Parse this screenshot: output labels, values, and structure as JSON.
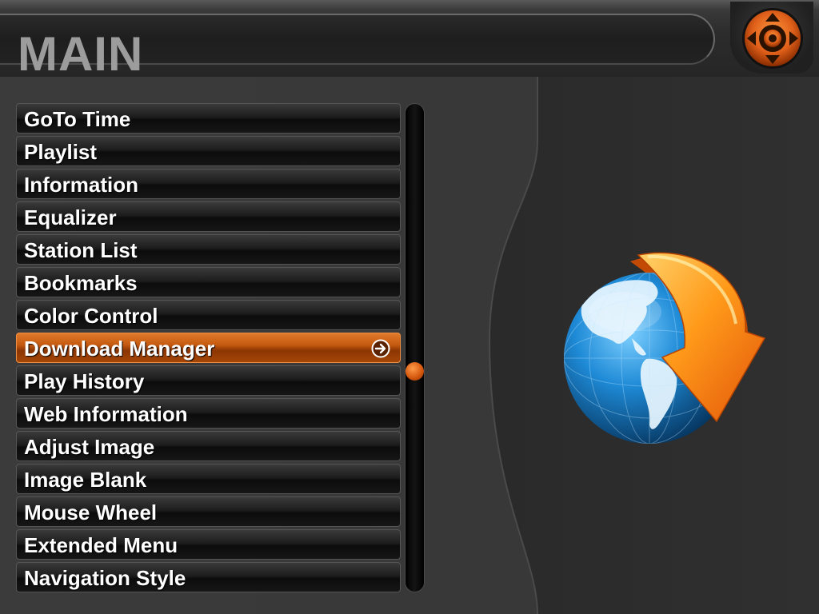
{
  "header": {
    "title": "MAIN"
  },
  "nav_control": {
    "icon": "directional-pad-icon",
    "accent_color": "#e8661a"
  },
  "menu": {
    "items": [
      {
        "label": "GoTo Time",
        "selected": false
      },
      {
        "label": "Playlist",
        "selected": false
      },
      {
        "label": "Information",
        "selected": false
      },
      {
        "label": "Equalizer",
        "selected": false
      },
      {
        "label": "Station List",
        "selected": false
      },
      {
        "label": "Bookmarks",
        "selected": false
      },
      {
        "label": "Color Control",
        "selected": false
      },
      {
        "label": "Download Manager",
        "selected": true,
        "icon": "arrow-right-circle-icon"
      },
      {
        "label": "Play History",
        "selected": false
      },
      {
        "label": "Web Information",
        "selected": false
      },
      {
        "label": "Adjust Image",
        "selected": false
      },
      {
        "label": "Image Blank",
        "selected": false
      },
      {
        "label": "Mouse Wheel",
        "selected": false
      },
      {
        "label": "Extended Menu",
        "selected": false
      },
      {
        "label": "Navigation Style",
        "selected": false
      }
    ],
    "selected_color": "#c45a10"
  },
  "scrollbar": {
    "position_fraction": 0.55
  },
  "preview": {
    "icon": "globe-download-icon"
  }
}
